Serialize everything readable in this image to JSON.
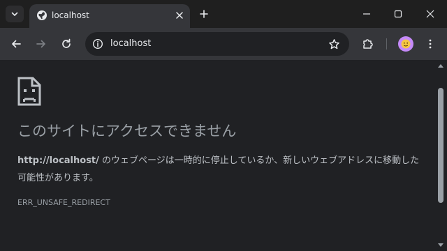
{
  "tab": {
    "title": "localhost",
    "icons": {
      "search": "chevron-down-icon",
      "favicon": "globe-icon",
      "close": "close-icon",
      "new_tab": "plus-icon"
    }
  },
  "window_controls": {
    "icons": [
      "minimize-icon",
      "maximize-icon",
      "close-icon"
    ]
  },
  "toolbar": {
    "url": "localhost",
    "icons": {
      "back": "arrow-left-icon",
      "forward": "arrow-right-icon",
      "reload": "reload-icon",
      "site_info": "info-icon",
      "bookmark": "star-icon",
      "extensions": "puzzle-icon",
      "menu": "kebab-icon"
    }
  },
  "error": {
    "title": "このサイトにアクセスできません",
    "url_bold": "http://localhost/",
    "description_rest": " のウェブページは一時的に停止しているか、新しいウェブアドレスに移動した可能性があります。",
    "code": "ERR_UNSAFE_REDIRECT"
  },
  "colors": {
    "page_bg": "#202124",
    "tab_active_bg": "#35363a",
    "text_primary": "#e8eaed",
    "text_secondary": "#9aa0a6",
    "avatar_bg": "#c58af9"
  }
}
